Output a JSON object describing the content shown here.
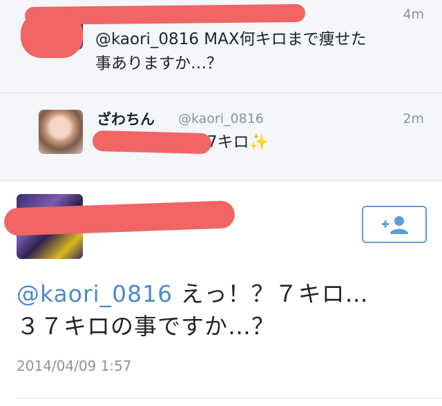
{
  "tweets": [
    {
      "time": "4m",
      "text_line1": "@kaori_0816 MAX何キロまで痩せた",
      "text_line2": "事ありますか…？"
    },
    {
      "name": "ざわちん",
      "handle": "@kaori_0816",
      "time": "2m",
      "text_visible": "7キロ✨"
    }
  ],
  "main_tweet": {
    "mention": "@kaori_0816",
    "text_line1_rest": " えっ！？７キロ…",
    "text_line2": "３７キロの事ですか…？",
    "date": "2014/04/09 1:57"
  },
  "icons": {
    "follow": "add-user-icon"
  },
  "colors": {
    "link": "#4a8bc9",
    "redaction": "#f26565",
    "follow_border": "#5a9fd8"
  }
}
